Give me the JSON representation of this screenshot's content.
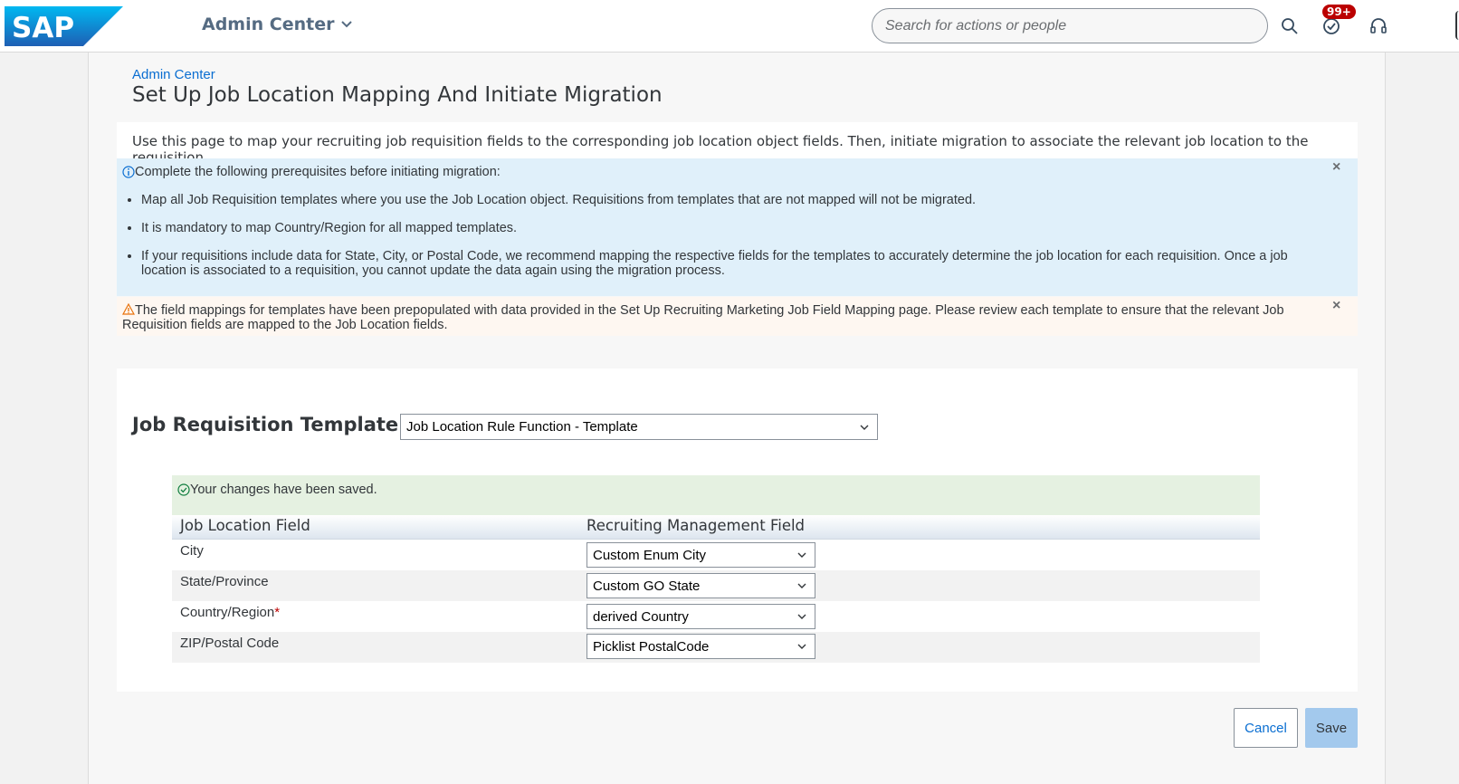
{
  "shell": {
    "logo_text": "SAP",
    "app_title": "Admin Center",
    "search_placeholder": "Search for actions or people",
    "notification_badge": "99+"
  },
  "page": {
    "breadcrumb": "Admin Center",
    "title": "Set Up Job Location Mapping And Initiate Migration",
    "description": "Use this page to map your recruiting job requisition fields to the corresponding job location object fields. Then, initiate migration to associate the relevant job location to the requisition."
  },
  "info": {
    "heading": "Complete the following prerequisites before initiating migration:",
    "items": [
      "Map all Job Requisition templates where you use the Job Location object. Requisitions from templates that are not mapped will not be migrated.",
      "It is mandatory to map Country/Region for all mapped templates.",
      "If your requisitions include data for State, City, or Postal Code, we recommend mapping the respective fields for the templates to accurately determine the job location for each requisition. Once a job location is associated to a requisition, you cannot update the data again using the migration process."
    ]
  },
  "warning": {
    "text": "The field mappings for templates have been prepopulated with data provided in the Set Up Recruiting Marketing Job Field Mapping page. Please review each template to ensure that the relevant Job Requisition fields are mapped to the Job Location fields."
  },
  "template": {
    "label": "Job Requisition Template",
    "selected": "Job Location Rule Function - Template"
  },
  "success_message": "Your changes have been saved.",
  "table": {
    "headers": [
      "Job Location Field",
      "Recruiting Management Field"
    ],
    "rows": [
      {
        "field": "City",
        "required": "",
        "value": "Custom Enum City"
      },
      {
        "field": "State/Province",
        "required": "",
        "value": "Custom GO State"
      },
      {
        "field": "Country/Region",
        "required": "*",
        "value": "derived Country"
      },
      {
        "field": "ZIP/Postal Code",
        "required": "",
        "value": "Picklist PostalCode"
      }
    ]
  },
  "buttons": {
    "cancel": "Cancel",
    "save": "Save"
  },
  "colors": {
    "brand": "#0a6ed1",
    "info_bg": "#e0f0fa",
    "warning_bg": "#fef7f1",
    "success_bg": "#e5f1e1",
    "badge": "#bb0000"
  }
}
